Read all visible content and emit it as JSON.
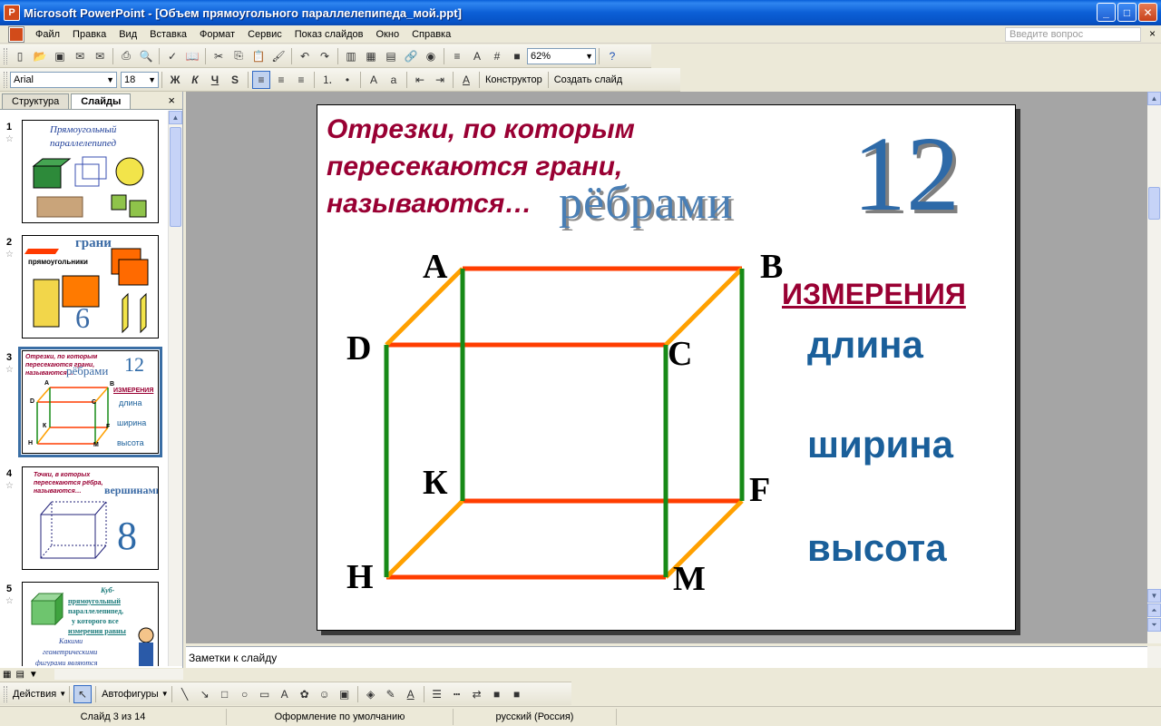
{
  "window": {
    "title": "Microsoft PowerPoint - [Объем прямоугольного параллелепипеда_мой.ppt]",
    "min_label": "_",
    "max_label": "□",
    "close_label": "✕"
  },
  "menu": {
    "items": [
      "Файл",
      "Правка",
      "Вид",
      "Вставка",
      "Формат",
      "Сервис",
      "Показ слайдов",
      "Окно",
      "Справка"
    ],
    "ask_placeholder": "Введите вопрос",
    "close_label": "×"
  },
  "toolbar1": {
    "zoom": "62%"
  },
  "toolbar2": {
    "font": "Arial",
    "font_size": "18",
    "bold": "Ж",
    "italic": "К",
    "underline": "Ч",
    "shadow": "S",
    "designer_label": "Конструктор",
    "new_slide_label": "Создать слайд"
  },
  "leftpane": {
    "tab_outline": "Структура",
    "tab_slides": "Слайды",
    "close_label": "×",
    "thumbs": [
      {
        "num": "1",
        "title_line1": "Прямоугольный",
        "title_line2": "параллелепипед"
      },
      {
        "num": "2",
        "word": "грани",
        "label": "прямоугольники",
        "number": "6"
      },
      {
        "num": "3",
        "title": "Отрезки, по которым пересекаются грани, называются…",
        "word": "рёбрами",
        "number": "12",
        "dims_head": "ИЗМЕРЕНИЯ",
        "dims": [
          "длина",
          "ширина",
          "высота"
        ]
      },
      {
        "num": "4",
        "title": "Точки, в которых пересекаются рёбра, называются…",
        "word": "вершинами",
        "number": "8"
      },
      {
        "num": "5",
        "line1": "Куб-",
        "line2": "прямоугольный",
        "line3": "параллелепипед,",
        "line4": "у которого все",
        "line5": "измерения равны",
        "line6": "Какими",
        "line7": "геометрическими",
        "line8": "фигурами являются"
      }
    ]
  },
  "slide": {
    "title_lines": [
      "Отрезки, по которым",
      "пересекаются грани,",
      "называются…"
    ],
    "answer": "рёбрами",
    "number": "12",
    "vertices": {
      "A": "A",
      "B": "B",
      "C": "C",
      "D": "D",
      "K": "К",
      "F": "F",
      "H": "H",
      "M": "M"
    },
    "dims_head": "ИЗМЕРЕНИЯ",
    "dims": [
      "длина",
      "ширина",
      "высота"
    ],
    "colors": {
      "red": "#ff3d00",
      "orange": "#ffa000",
      "green": "#178a17",
      "title": "#990033",
      "dims": "#1a5f9a"
    }
  },
  "notes": {
    "placeholder": "Заметки к слайду"
  },
  "drawbar": {
    "actions": "Действия",
    "autoshapes": "Автофигуры"
  },
  "status": {
    "slide": "Слайд 3 из 14",
    "design": "Оформление по умолчанию",
    "language": "русский (Россия)"
  }
}
